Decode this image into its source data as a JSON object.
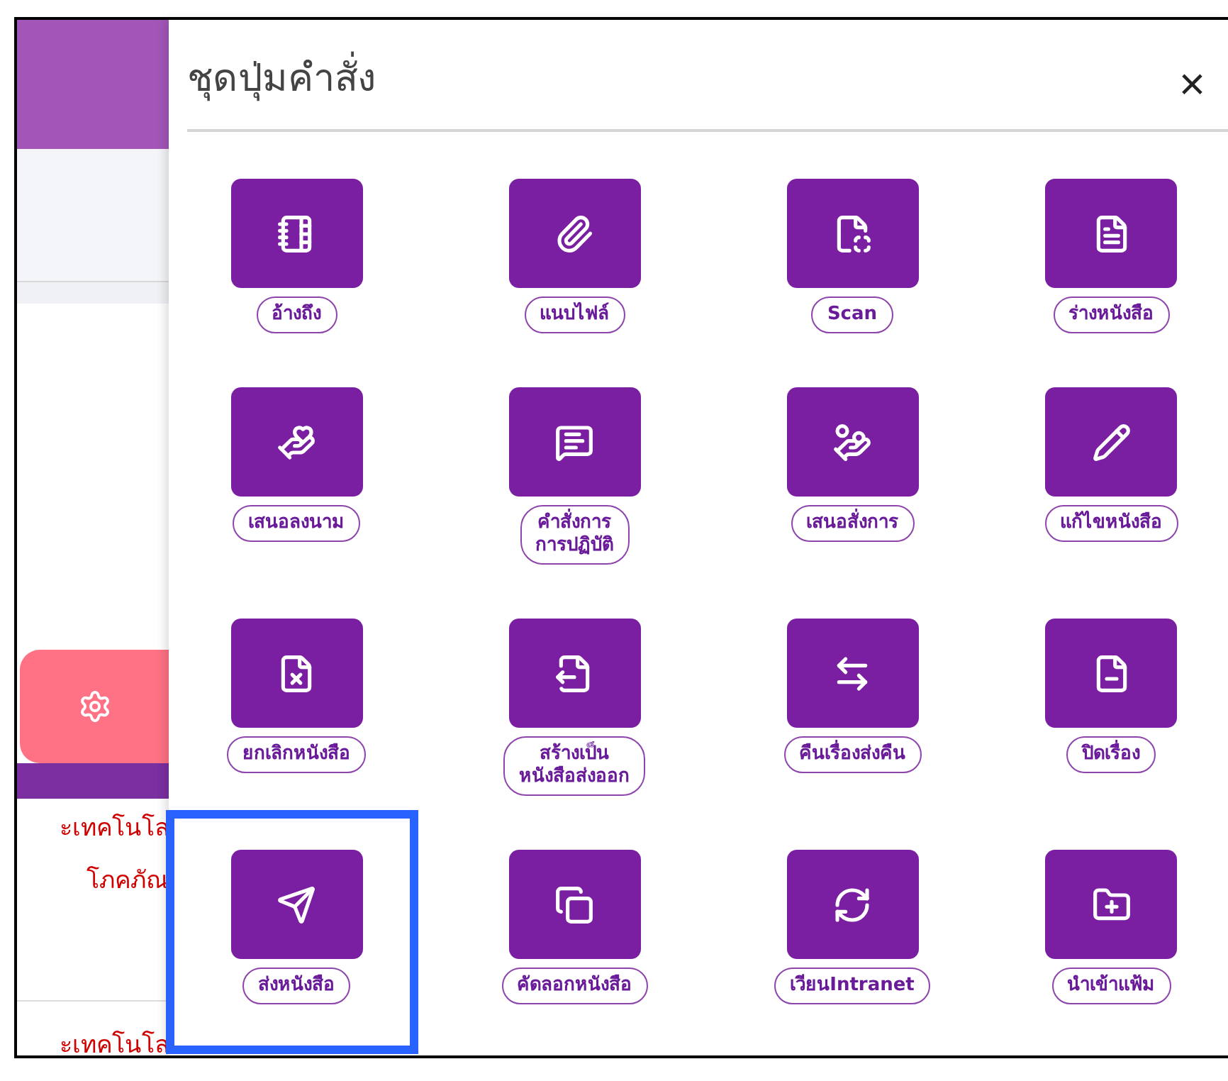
{
  "background": {
    "texts": [
      "ะเทคโนโล",
      "โภคภัณ",
      "ะเทคโนโล"
    ]
  },
  "panel": {
    "title": "ชุดปุ่มคำสั่ง",
    "close": "×",
    "commands": [
      {
        "label": "อ้างถึง",
        "selected": false
      },
      {
        "label": "แนบไฟล์",
        "selected": false
      },
      {
        "label": "Scan",
        "selected": false
      },
      {
        "label": "ร่างหนังสือ",
        "selected": false
      },
      {
        "label": "เสนอลงนาม",
        "selected": false
      },
      {
        "label": "คำสั่งการ\nการปฏิบัติ",
        "selected": false
      },
      {
        "label": "เสนอสั่งการ",
        "selected": false
      },
      {
        "label": "แก้ไขหนังสือ",
        "selected": false
      },
      {
        "label": "ยกเลิกหนังสือ",
        "selected": false
      },
      {
        "label": "สร้างเป็น\nหนังสือส่งออก",
        "selected": false
      },
      {
        "label": "คืนเรื่องส่งคืน",
        "selected": false
      },
      {
        "label": "ปิดเรื่อง",
        "selected": false
      },
      {
        "label": "ส่งหนังสือ",
        "selected": true
      },
      {
        "label": "คัดลอกหนังสือ",
        "selected": false
      },
      {
        "label": "เวียนIntranet",
        "selected": false
      },
      {
        "label": "นำเข้าแฟ้ม",
        "selected": false
      }
    ]
  }
}
